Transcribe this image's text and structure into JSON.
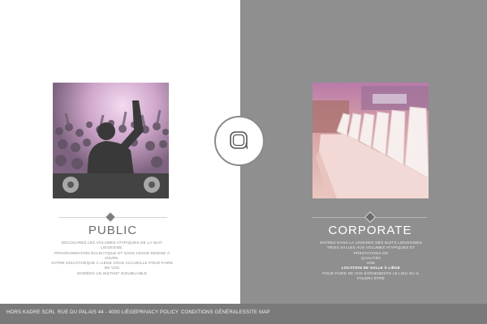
{
  "left_panel": {
    "title": "PUBLIC",
    "description_lines": [
      "DÉCOUVREZ LES VOLUMES ATYPIQUES DE LA NUIT LIÉGEOISE.",
      "PROGRAMMATION ÉCLECTIQUE ET SANS CESSE REMISE À JOURS.",
      "VOTRE DISCOTHÈQUE À LIÈGE VOUS ACCUEILLE POUR FAIRE DE VOS",
      "SOIRÉES UN INSTANT INOUBLIABLE"
    ],
    "image": "dj-crowd-photo"
  },
  "right_panel": {
    "title": "CORPORATE",
    "description_lines": [
      "ENTREZ DANS LA LÉGENDE DES NUITS LIÉGEOISES",
      "TROIS SALLES AUX VOLUMES ATYPIQUES ET PRESTATIONS DE",
      "QUALITÉS",
      "UNE"
    ],
    "description_strong": "LOCATION DE SALLE À LIÈGE",
    "description_tail": "POUR FAIRE DE VOS ÉVÉNEMENTS LE LIEU OÙ IL FAUDRA ÊTRE",
    "image": "white-seats-venue-photo"
  },
  "center_logo": {
    "icon": "brand-logo-icon"
  },
  "footer": {
    "company": "HORS KADRE SCRL",
    "address": "RUE DU PALAIS 44 - 4000 LIÈGE",
    "privacy": "PRIVACY POLICY",
    "terms": "CONDITIONS GÉNÉRALES",
    "sitemap": "SITE MAP"
  },
  "colors": {
    "left_bg": "#ffffff",
    "right_bg": "#8f8f8f",
    "footer_bg": "#7a7a7a"
  }
}
